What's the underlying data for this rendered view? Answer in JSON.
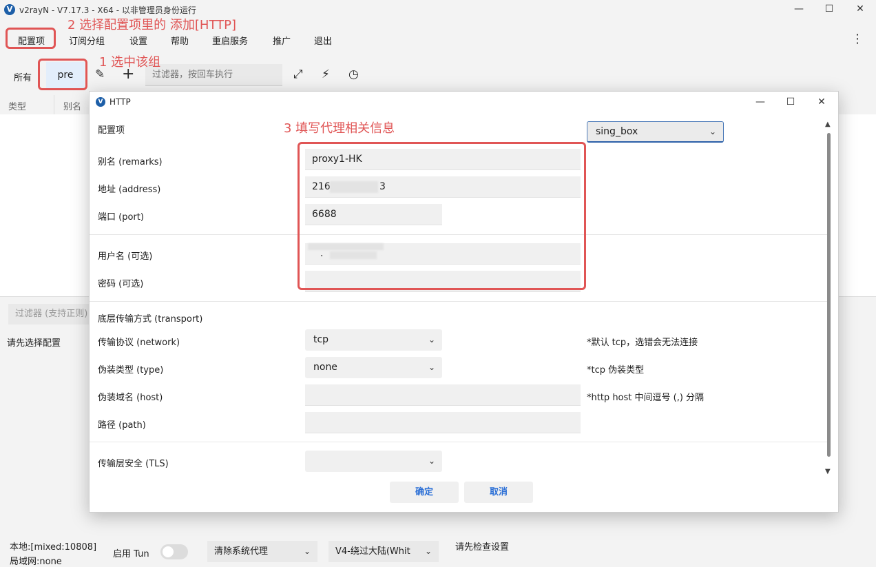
{
  "window": {
    "title": "v2rayN - V7.17.3 - X64 - 以非管理员身份运行",
    "app_icon": "v2rayn-logo-icon",
    "controls": {
      "minimize": "—",
      "maximize": "☐",
      "close": "✕"
    }
  },
  "menu": {
    "items": [
      "配置项",
      "订阅分组",
      "设置",
      "帮助",
      "重启服务",
      "推广",
      "退出"
    ],
    "more": "⋮"
  },
  "toolbar": {
    "tab_all": "所有",
    "tab_pre": "pre",
    "filter_placeholder": "过滤器，按回车执行",
    "icons": {
      "edit": "✎",
      "add": "+",
      "expand": "⤢",
      "speed": "⚡",
      "test": "◷"
    }
  },
  "table": {
    "headers": [
      "类型",
      "别名"
    ]
  },
  "bottom": {
    "filter_placeholder": "过滤器 (支持正则)",
    "select_first": "请先选择配置"
  },
  "statusbar": {
    "local": "本地:[mixed:10808]",
    "lan": "局域网:none",
    "tun_label": "启用 Tun",
    "tun_enabled": false,
    "proxy_mode": "清除系统代理",
    "routing": "V4-绕过大陆(Whit",
    "notice": "请先检查设置"
  },
  "dialog": {
    "title": "HTTP",
    "config_label": "配置项",
    "core_value": "sing_box",
    "fields": {
      "remarks_label": "别名 (remarks)",
      "remarks_value": "proxy1-HK",
      "address_label": "地址 (address)",
      "address_value": "216.",
      "address_tail": "3",
      "port_label": "端口 (port)",
      "port_value": "6688",
      "username_label": "用户名 (可选)",
      "username_value": ".",
      "password_label": "密码 (可选)",
      "password_value": ""
    },
    "transport": {
      "section": "底层传输方式 (transport)",
      "network_label": "传输协议 (network)",
      "network_value": "tcp",
      "network_hint": "*默认 tcp，选错会无法连接",
      "type_label": "伪装类型 (type)",
      "type_value": "none",
      "type_hint": "*tcp 伪装类型",
      "host_label": "伪装域名 (host)",
      "host_value": "",
      "host_hint": "*http host 中间逗号 (,) 分隔",
      "path_label": "路径 (path)",
      "path_value": ""
    },
    "tls_label": "传输层安全 (TLS)",
    "tls_value": "",
    "ok": "确定",
    "cancel": "取消"
  },
  "annotations": {
    "step1": "1 选中该组",
    "step2": "2 选择配置项里的 添加[HTTP]",
    "step3": "3 填写代理相关信息",
    "color": "#e05555"
  }
}
